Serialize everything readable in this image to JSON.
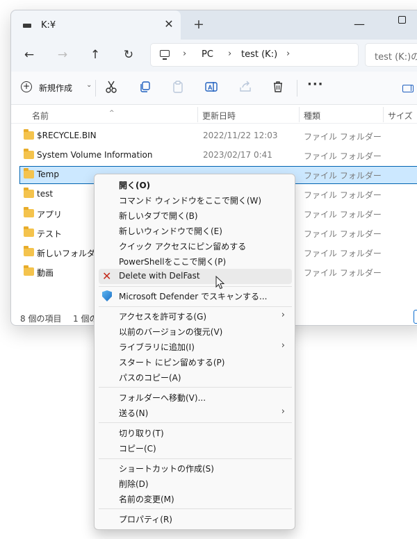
{
  "titlebar": {
    "tab_title": "K:¥",
    "tab_close": "✕",
    "new_tab": "+",
    "minimize": "—"
  },
  "navigation": {
    "back": "←",
    "forward": "→",
    "up": "↑",
    "refresh": "↻",
    "breadcrumb": [
      "PC",
      "test (K:)"
    ],
    "breadcrumb_sep": "›",
    "search_placeholder": "test (K:)の"
  },
  "toolbar": {
    "new_label": "新規作成",
    "new_chevron": "⌄",
    "more": "···"
  },
  "columns": {
    "name": "名前",
    "date": "更新日時",
    "type": "種類",
    "size": "サイズ"
  },
  "files": [
    {
      "name": "$RECYCLE.BIN",
      "date": "2022/11/22 12:03",
      "type": "ファイル フォルダー"
    },
    {
      "name": "System Volume Information",
      "date": "2023/02/17 0:41",
      "type": "ファイル フォルダー"
    },
    {
      "name": "Temp",
      "date": "",
      "type": "ファイル フォルダー"
    },
    {
      "name": "test",
      "date": "",
      "type": "ファイル フォルダー"
    },
    {
      "name": "アプリ",
      "date": "",
      "type": "ファイル フォルダー"
    },
    {
      "name": "テスト",
      "date": "",
      "type": "ファイル フォルダー"
    },
    {
      "name": "新しいフォルダー",
      "date": "",
      "type": "ファイル フォルダー"
    },
    {
      "name": "動画",
      "date": "",
      "type": "ファイル フォルダー"
    }
  ],
  "status": {
    "count": "8 個の項目",
    "selected": "1 個の"
  },
  "context_menu": {
    "open": "開く(O)",
    "open_cmd": "コマンド ウィンドウをここで開く(W)",
    "open_new_tab": "新しいタブで開く(B)",
    "open_new_window": "新しいウィンドウで開く(E)",
    "pin_quick_access": "クイック アクセスにピン留めする",
    "open_powershell": "PowerShellをここで開く(P)",
    "delete_delfast": "Delete with DelFast",
    "defender_scan": "Microsoft Defender でスキャンする...",
    "give_access": "アクセスを許可する(G)",
    "restore_versions": "以前のバージョンの復元(V)",
    "add_library": "ライブラリに追加(I)",
    "pin_start": "スタート にピン留めする(P)",
    "copy_path": "パスのコピー(A)",
    "move_to_folder": "フォルダーへ移動(V)...",
    "send_to": "送る(N)",
    "cut": "切り取り(T)",
    "copy": "コピー(C)",
    "create_shortcut": "ショートカットの作成(S)",
    "delete": "削除(D)",
    "rename": "名前の変更(M)",
    "properties": "プロパティ(R)",
    "submenu_arrow": "›",
    "delete_icon": "✕"
  }
}
